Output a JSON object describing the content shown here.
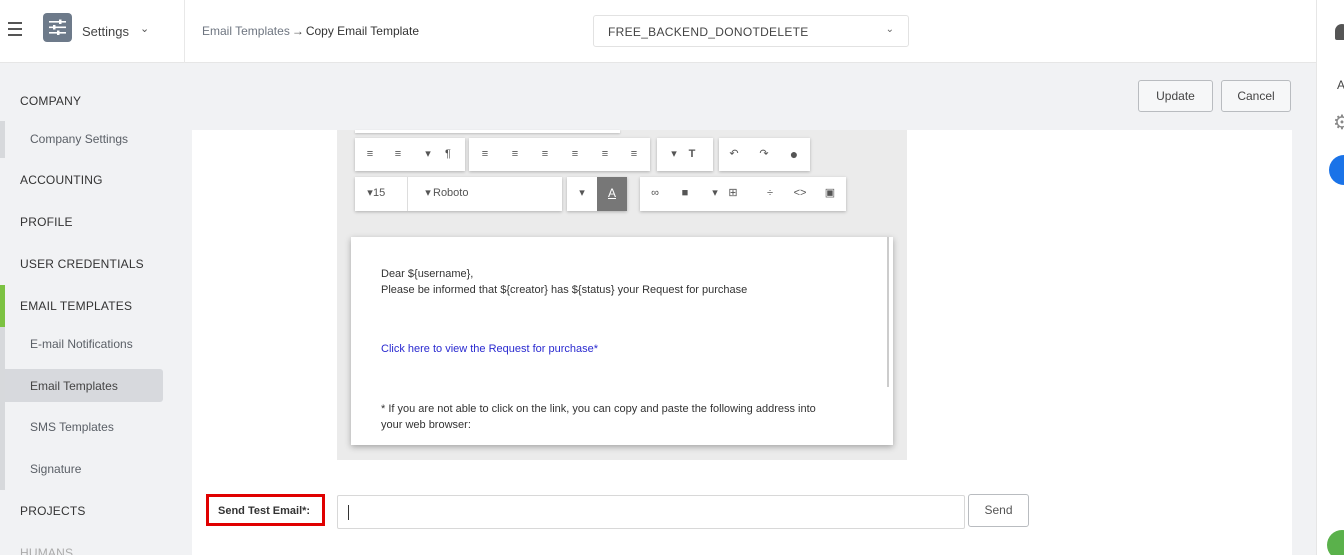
{
  "header": {
    "app_name": "Settings",
    "breadcrumb": {
      "parent": "Email Templates",
      "separator": "→",
      "current": "Copy Email Template"
    },
    "database_select": {
      "value": "FREE_BACKEND_DONOTDELETE"
    }
  },
  "right_rail": {
    "letter": "A"
  },
  "sidebar": {
    "sections": [
      {
        "label": "COMPANY"
      },
      {
        "label": "ACCOUNTING"
      },
      {
        "label": "PROFILE"
      },
      {
        "label": "USER CREDENTIALS"
      },
      {
        "label": "EMAIL TEMPLATES"
      },
      {
        "label": "PROJECTS"
      },
      {
        "label": "HUMANS"
      }
    ],
    "items": [
      {
        "label": "Company Settings"
      },
      {
        "label": "E-mail Notifications"
      },
      {
        "label": "Email Templates"
      },
      {
        "label": "SMS Templates"
      },
      {
        "label": "Signature"
      }
    ]
  },
  "actions": {
    "update_label": "Update",
    "cancel_label": "Cancel"
  },
  "editor": {
    "font_size": "15",
    "font_family": "Roboto",
    "body": {
      "greeting": "Dear ${username},",
      "line1": "Please be informed that ${creator} has ${status} your Request for purchase",
      "link": "Click here to view the Request for purchase*",
      "note_line1": "* If you are not able to click on the link, you can copy and paste the following address into",
      "note_line2": "your web browser:"
    }
  },
  "test_email": {
    "label": "Send Test Email*:",
    "value": "",
    "send_label": "Send"
  },
  "colors": {
    "accent_green": "#7cc242",
    "highlight_red": "#e00000",
    "link_blue": "#2a2ad0"
  }
}
